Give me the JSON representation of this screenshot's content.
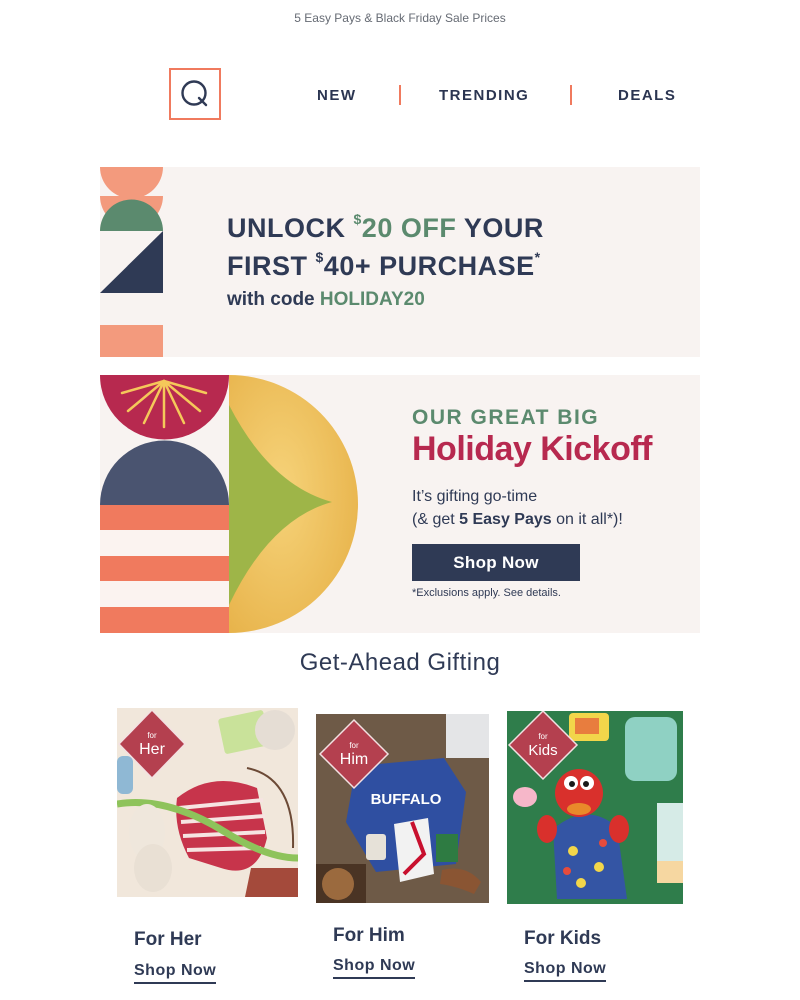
{
  "preheader": "5 Easy Pays & Black Friday Sale Prices",
  "logo": {
    "letter": "Q"
  },
  "nav": [
    {
      "label": "NEW"
    },
    {
      "label": "TRENDING"
    },
    {
      "label": "DEALS"
    }
  ],
  "promo_code_banner": {
    "line1_prefix": "UNLOCK ",
    "line1_currency": "$",
    "line1_amount": "20 OFF",
    "line1_suffix": " YOUR",
    "line2_prefix": "FIRST ",
    "line2_currency": "$",
    "line2_amount": "40+ PURCHASE",
    "line2_mark": "*",
    "code_prefix": "with code ",
    "code": "HOLIDAY20"
  },
  "holiday_banner": {
    "eyebrow": "OUR GREAT BIG",
    "title": "Holiday Kickoff",
    "body_line1": "It’s gifting go-time",
    "body_line2_prefix": "(& get ",
    "body_line2_bold": "5 Easy Pays",
    "body_line2_suffix": " on it all*)!",
    "button_label": "Shop Now",
    "disclaimer": "*Exclusions apply. See details."
  },
  "section_title": "Get-Ahead Gifting",
  "gift_cards": [
    {
      "badge_small": "for",
      "badge_big": "Her",
      "title": "For Her",
      "link": "Shop Now"
    },
    {
      "badge_small": "for",
      "badge_big": "Him",
      "title": "For Him",
      "link": "Shop Now"
    },
    {
      "badge_small": "for",
      "badge_big": "Kids",
      "title": "For Kids",
      "link": "Shop Now"
    }
  ],
  "colors": {
    "navy": "#2f3a55",
    "coral": "#f07a5e",
    "green": "#5b8a6e",
    "crimson": "#b7294f",
    "cream": "#f8f3f1"
  }
}
